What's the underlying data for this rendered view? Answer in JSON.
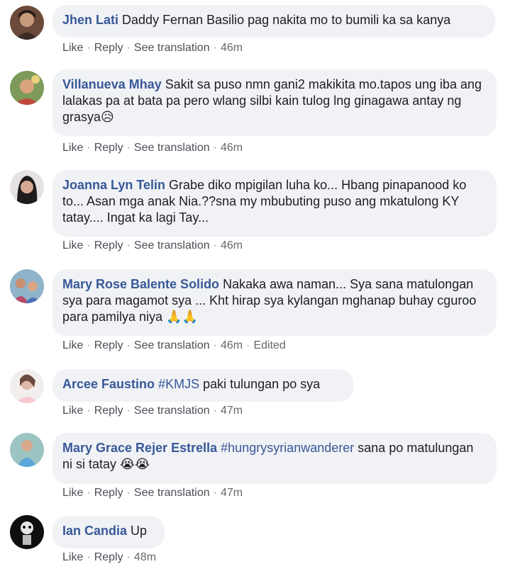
{
  "actions": {
    "like": "Like",
    "reply": "Reply",
    "see_translation": "See translation",
    "separator": "·"
  },
  "comments": [
    {
      "author": "Jhen Lati",
      "text": "Daddy Fernan Basilio pag nakita mo to bumili ka sa kanya",
      "time": "46m"
    },
    {
      "author": "Villanueva Mhay",
      "text": "Sakit sa puso nmn gani2 makikita mo.tapos ung iba ang lalakas pa at bata pa pero wlang silbi kain tulog lng ginagawa antay ng grasya😥",
      "time": "46m"
    },
    {
      "author": "Joanna Lyn Telin",
      "text": "Grabe diko mpigilan luha ko... Hbang pinapanood ko to... Asan mga anak Nia.??sna my mbubuting puso ang mkatulong KY tatay.... Ingat ka lagi Tay...",
      "time": "46m"
    },
    {
      "author": "Mary Rose Balente Solido",
      "text": "Nakaka awa naman... Sya sana matulongan sya para magamot sya ... Kht hirap sya kylangan mghanap buhay cguroo para pamilya niya 🙏🙏",
      "time": "46m",
      "edited": "Edited"
    },
    {
      "author": "Arcee Faustino",
      "tag": "#KMJS",
      "text": "paki tulungan po sya",
      "time": "47m"
    },
    {
      "author": "Mary Grace Rejer Estrella",
      "tag": "#hungrysyrianwanderer",
      "text": "sana po matulungan ni si tatay 😭😭",
      "time": "47m"
    },
    {
      "author": "Ian Candia",
      "text": "Up",
      "time": "48m"
    }
  ]
}
